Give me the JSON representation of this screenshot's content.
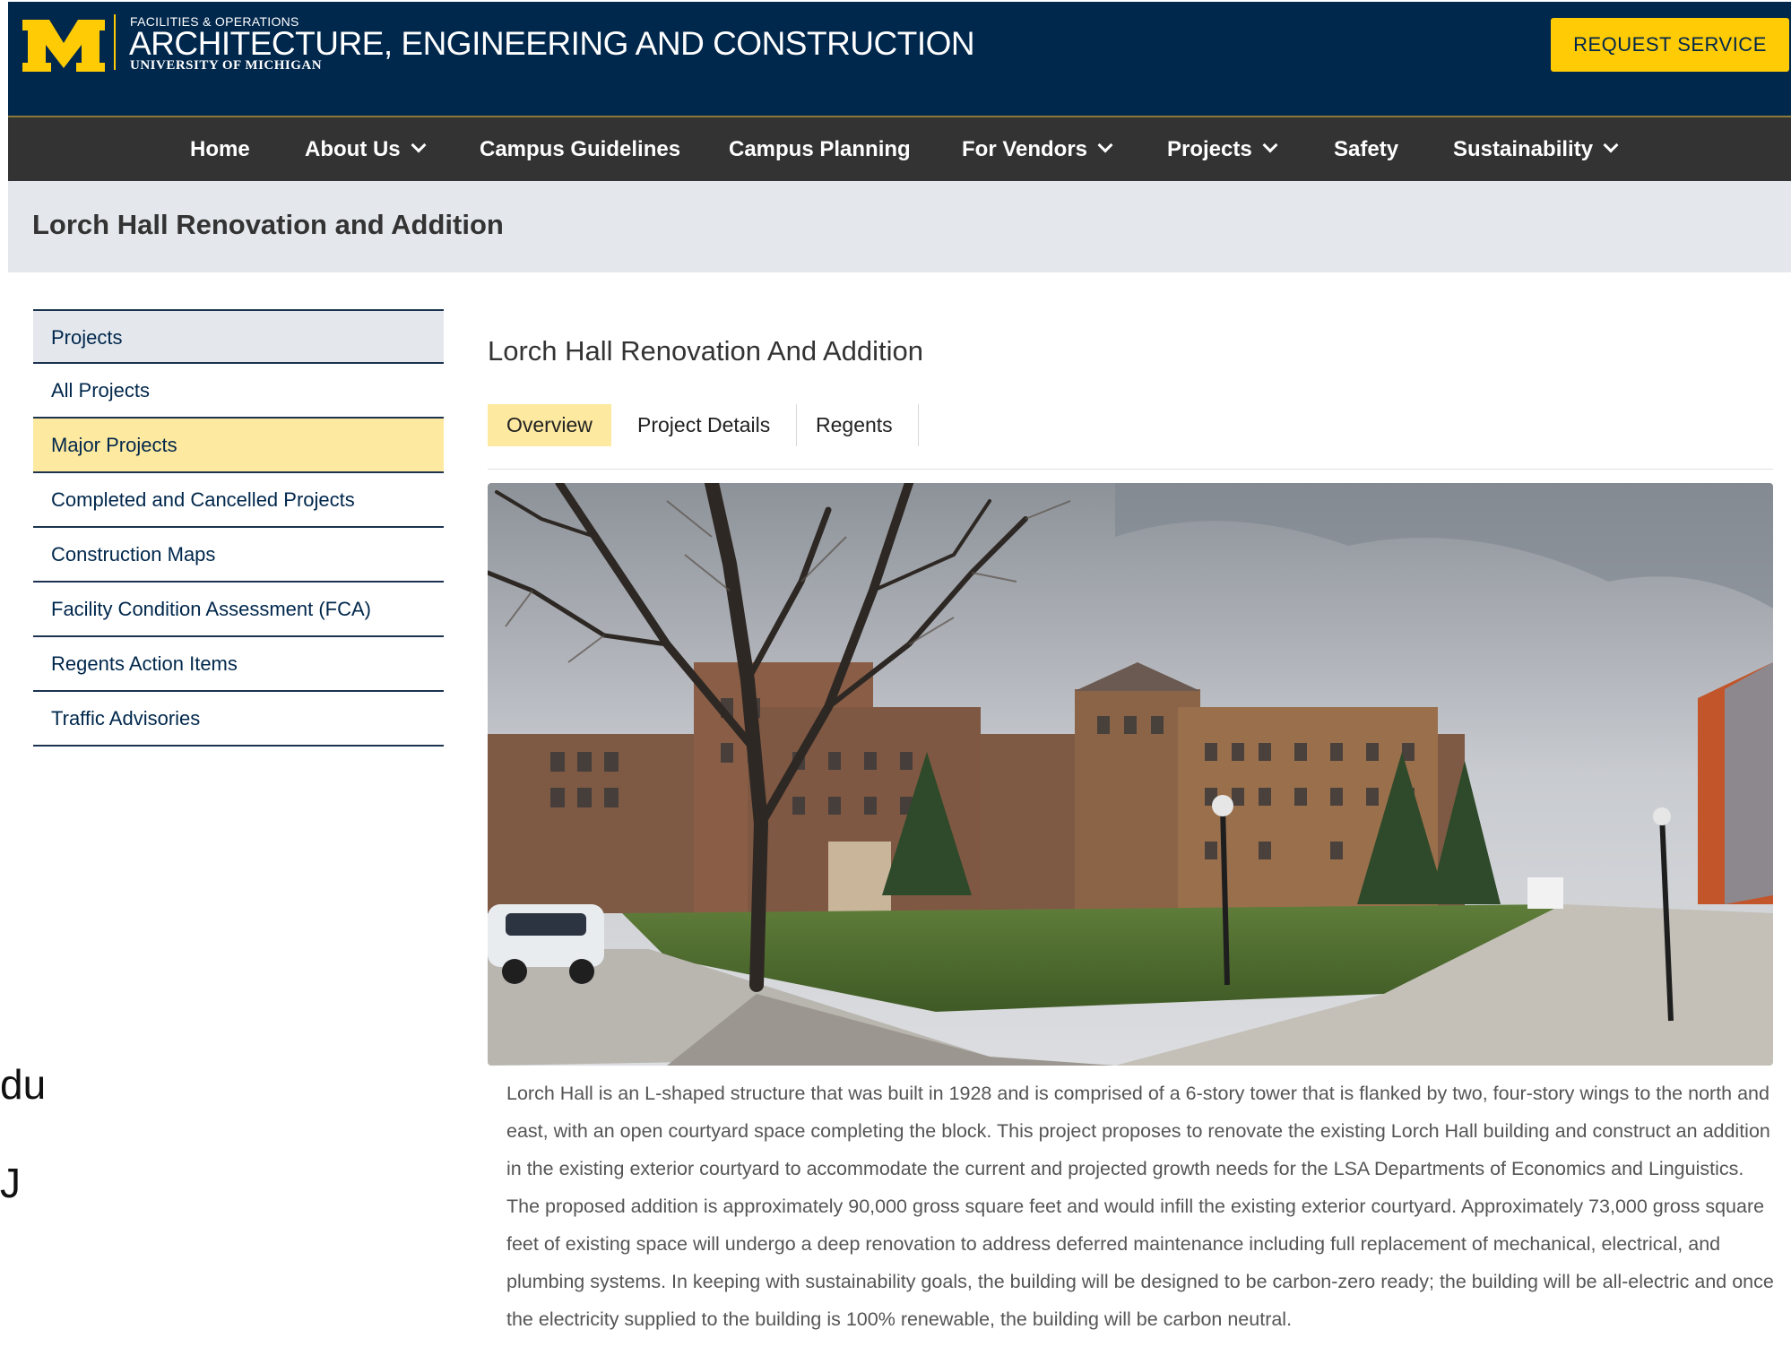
{
  "header": {
    "unit_small": "FACILITIES & OPERATIONS",
    "unit_title": "ARCHITECTURE, ENGINEERING AND CONSTRUCTION",
    "unit_sub": "UNIVERSITY OF MICHIGAN",
    "request_button": "REQUEST SERVICE",
    "brand_blue": "#00274c",
    "brand_maize": "#ffcb05"
  },
  "nav": {
    "items": [
      {
        "label": "Home"
      },
      {
        "label": "About Us"
      },
      {
        "label": "Campus Guidelines"
      },
      {
        "label": "Campus Planning"
      },
      {
        "label": "For Vendors"
      },
      {
        "label": "Projects"
      },
      {
        "label": "Safety"
      },
      {
        "label": "Sustainability"
      }
    ]
  },
  "page": {
    "title": "Lorch Hall Renovation and Addition"
  },
  "sidebar": {
    "items": [
      {
        "label": "Projects"
      },
      {
        "label": "All Projects"
      },
      {
        "label": "Major Projects"
      },
      {
        "label": "Completed and Cancelled Projects"
      },
      {
        "label": "Construction Maps"
      },
      {
        "label": "Facility Condition Assessment (FCA)"
      },
      {
        "label": "Regents Action Items"
      },
      {
        "label": "Traffic Advisories"
      }
    ],
    "active": "Major Projects"
  },
  "main": {
    "heading": "Lorch Hall Renovation And Addition",
    "tabs": [
      {
        "label": "Overview"
      },
      {
        "label": "Project Details"
      },
      {
        "label": "Regents"
      }
    ],
    "active_tab": "Overview",
    "description": "Lorch Hall is an L-shaped structure that was built in 1928 and is comprised of a 6-story tower that is flanked by two, four-story wings to the north and east, with an open courtyard space completing the block. This project proposes to renovate the existing Lorch Hall building and construct an addition in the existing exterior courtyard to accommodate the current and projected growth needs for the LSA Departments of Economics and Linguistics. The proposed addition is approximately 90,000 gross square feet and would infill the existing exterior courtyard. Approximately 73,000 gross square feet of existing space will undergo a deep renovation to address deferred maintenance including full replacement of mechanical, electrical, and plumbing systems. In keeping with sustainability goals, the building will be designed to be carbon-zero ready; the building will be all-electric and once the electricity supplied to the building is 100% renewable, the building will be carbon neutral."
  },
  "edge_fragments": [
    "du",
    "J"
  ]
}
